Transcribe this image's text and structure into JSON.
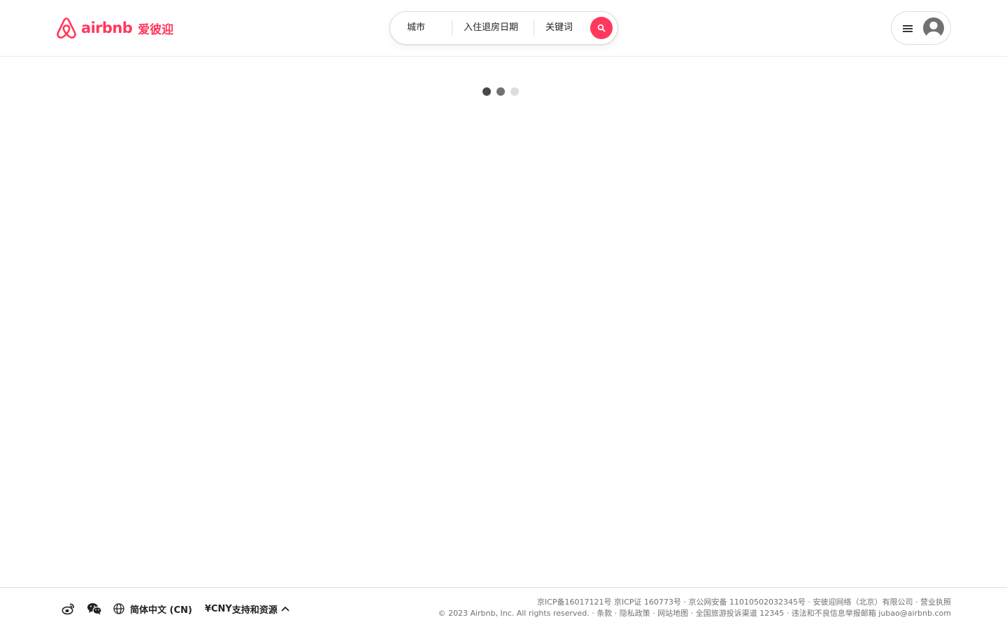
{
  "brand": {
    "name": "airbnb",
    "cn_name": "爱彼迎",
    "color": "#ff385c"
  },
  "search": {
    "city": "城市",
    "dates": "入住退房日期",
    "keyword": "关键词",
    "button_icon": "search-icon"
  },
  "user_menu": {
    "menu_icon": "hamburger-icon",
    "avatar_icon": "user-avatar-icon"
  },
  "loader": {
    "dot_colors": [
      "#484848",
      "#717171",
      "#dddddd"
    ]
  },
  "footer": {
    "social_icons": [
      "weibo-icon",
      "wechat-icon"
    ],
    "language_icon": "globe-icon",
    "language": "简体中文 (CN)",
    "currency": "¥CNY",
    "support": "支持和资源",
    "support_icon": "chevron-up-icon",
    "legal_line1": {
      "icp1": "京ICP备16017121号",
      "icp2": "京ICP证 160773号",
      "psb": "京公网安备 11010502032345号",
      "company": "安彼迎网络（北京）有限公司",
      "license": "营业执照"
    },
    "legal_line2": {
      "copyright": "© 2023 Airbnb, Inc. All rights reserved.",
      "terms": "条款",
      "privacy": "隐私政策",
      "sitemap": "网站地图",
      "complaint": "全国旅游投诉渠道 12345",
      "report": "违法和不良信息举报邮箱 jubao@airbnb.com"
    }
  }
}
